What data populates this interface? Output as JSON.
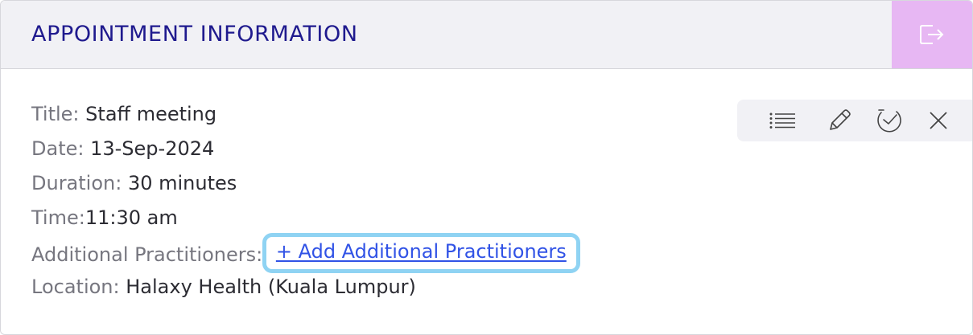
{
  "header": {
    "title": "APPOINTMENT INFORMATION",
    "exit_icon": "exit-icon",
    "accent_color": "#e7b7f3",
    "title_color": "#1f1a8e"
  },
  "details": {
    "title_label": "Title:",
    "title_value": "Staff meeting",
    "date_label": "Date:",
    "date_value": "13-Sep-2024",
    "duration_label": "Duration:",
    "duration_value": "30 minutes",
    "time_label": "Time:",
    "time_value": "11:30 am",
    "practitioners_label": "Additional Practitioners:",
    "practitioners_link": "+ Add Additional Practitioners",
    "location_label": "Location:",
    "location_value": "Halaxy Health (Kuala Lumpur)"
  },
  "toolbar": {
    "icons": [
      "list-icon",
      "pencil-icon",
      "clock-check-icon",
      "close-icon"
    ]
  },
  "colors": {
    "link": "#3153e6",
    "highlight_border": "#8fd3f3"
  }
}
